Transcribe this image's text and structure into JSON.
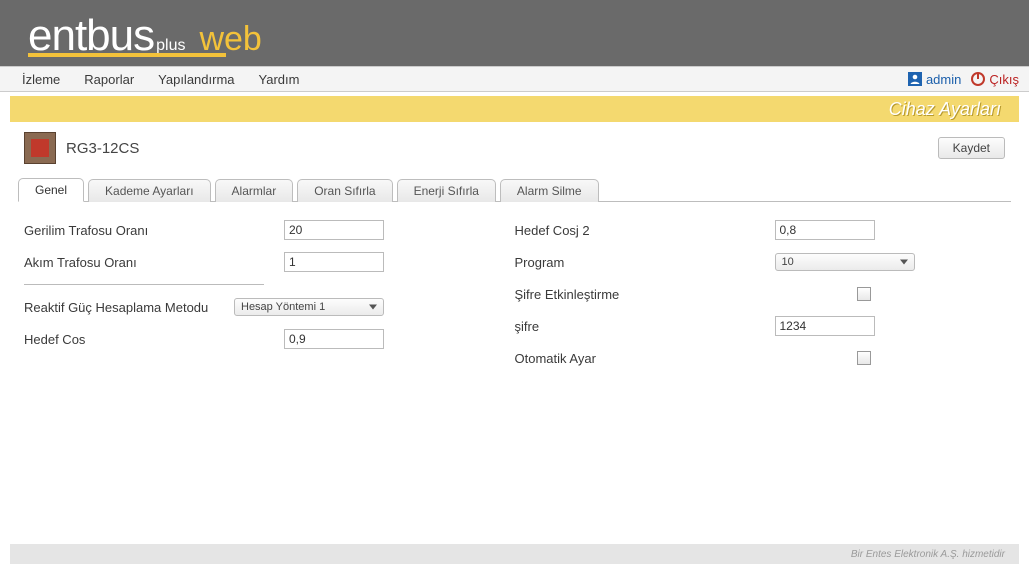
{
  "logo": {
    "brand1": "entbus",
    "brand_suffix": "plus",
    "brand2": "web"
  },
  "menu": {
    "items": [
      "İzleme",
      "Raporlar",
      "Yapılandırma",
      "Yardım"
    ]
  },
  "user": {
    "name": "admin",
    "logout_label": "Çıkış"
  },
  "page_title": "Cihaz Ayarları",
  "device": {
    "name": "RG3-12CS"
  },
  "buttons": {
    "save": "Kaydet"
  },
  "tabs": [
    "Genel",
    "Kademe Ayarları",
    "Alarmlar",
    "Oran Sıfırla",
    "Enerji Sıfırla",
    "Alarm Silme"
  ],
  "active_tab": 0,
  "form": {
    "left": {
      "gerilim_trafosu_orani": {
        "label": "Gerilim Trafosu Oranı",
        "value": "20"
      },
      "akim_trafosu_orani": {
        "label": "Akım Trafosu Oranı",
        "value": "1"
      },
      "reaktif_guc_hesaplama": {
        "label": "Reaktif Güç Hesaplama Metodu",
        "value": "Hesap Yöntemi 1"
      },
      "hedef_cos": {
        "label": "Hedef Cos",
        "value": "0,9"
      }
    },
    "right": {
      "hedef_cosj2": {
        "label": "Hedef Cosj 2",
        "value": "0,8"
      },
      "program": {
        "label": "Program",
        "value": "10"
      },
      "sifre_etkin": {
        "label": "Şifre Etkinleştirme",
        "checked": false
      },
      "sifre": {
        "label": "şifre",
        "value": "1234"
      },
      "otomatik_ayar": {
        "label": "Otomatik Ayar",
        "checked": false
      }
    }
  },
  "footer": "Bir Entes Elektronik A.Ş. hizmetidir"
}
